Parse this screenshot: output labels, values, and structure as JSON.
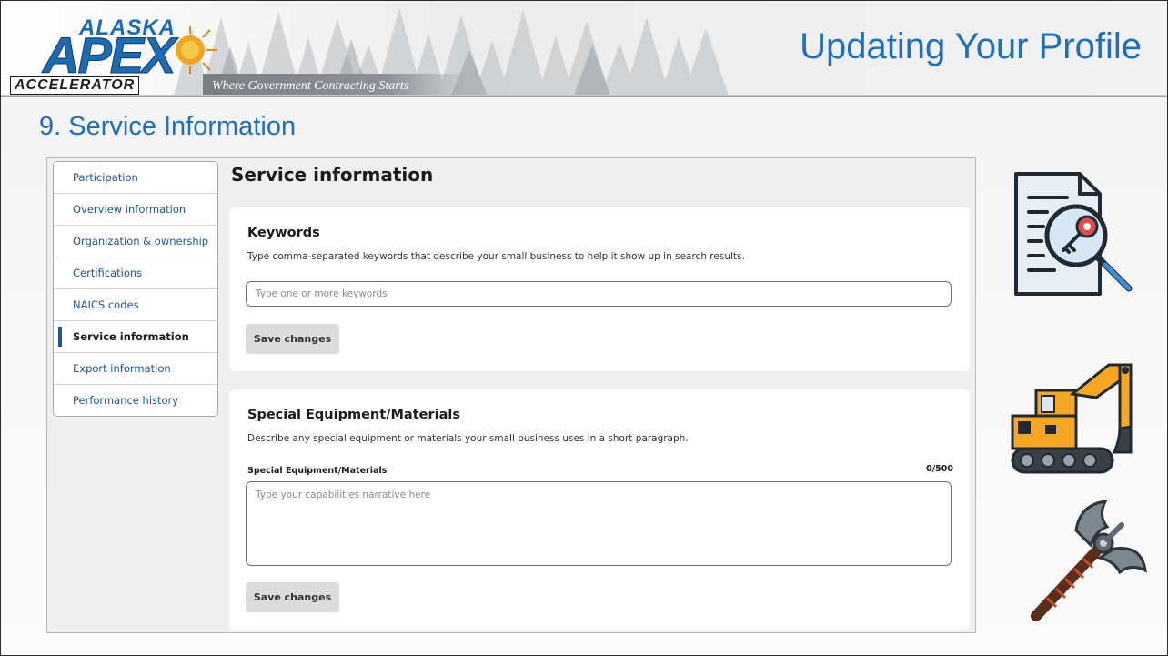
{
  "header": {
    "logo_top": "ALASKA",
    "logo_main": "APEX",
    "logo_bottom": "ACCELERATOR",
    "tagline": "Where Government Contracting Starts",
    "title": "Updating Your Profile"
  },
  "section_title": "9. Service Information",
  "sidenav": {
    "items": [
      {
        "label": "Participation"
      },
      {
        "label": "Overview information"
      },
      {
        "label": "Organization & ownership"
      },
      {
        "label": "Certifications"
      },
      {
        "label": "NAICS codes"
      },
      {
        "label": "Service information",
        "active": true
      },
      {
        "label": "Export information"
      },
      {
        "label": "Performance history"
      }
    ]
  },
  "main": {
    "heading": "Service information",
    "keywords": {
      "title": "Keywords",
      "description": "Type comma-separated keywords that describe your small business to help it show up in search results.",
      "placeholder": "Type one or more keywords",
      "value": "",
      "save_label": "Save changes"
    },
    "equipment": {
      "title": "Special Equipment/Materials",
      "description": "Describe any special equipment or materials your small business uses in a short paragraph.",
      "field_label": "Special Equipment/Materials",
      "counter": "0/500",
      "placeholder": "Type your capabilities narrative here",
      "value": "",
      "save_label": "Save changes"
    }
  },
  "colors": {
    "title_blue": "#1e6fc2",
    "link_blue": "#1b53a6",
    "button_gray": "#dcdcdc"
  },
  "icons": [
    "document-key-search-icon",
    "excavator-icon",
    "battle-axe-icon"
  ]
}
